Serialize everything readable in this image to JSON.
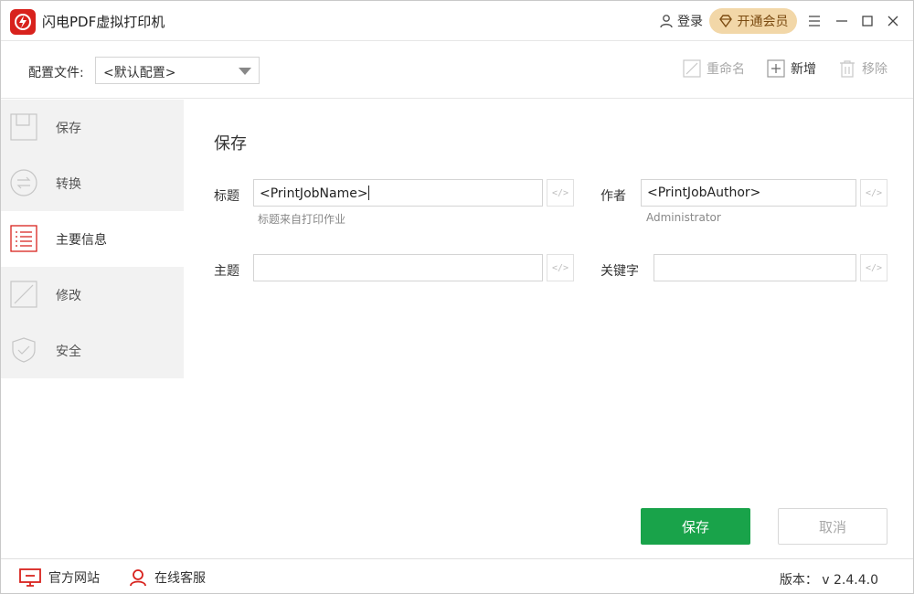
{
  "app": {
    "title": "闪电PDF虚拟打印机"
  },
  "header": {
    "login_label": "登录",
    "vip_label": "开通会员"
  },
  "toolbar": {
    "config_label": "配置文件:",
    "config_value": "<默认配置>",
    "rename_label": "重命名",
    "new_label": "新增",
    "remove_label": "移除"
  },
  "sidebar": {
    "items": [
      {
        "label": "保存",
        "icon": "save-icon"
      },
      {
        "label": "转换",
        "icon": "convert-icon"
      },
      {
        "label": "主要信息",
        "icon": "list-icon"
      },
      {
        "label": "修改",
        "icon": "edit-icon"
      },
      {
        "label": "安全",
        "icon": "shield-icon"
      }
    ]
  },
  "main": {
    "section_title": "保存",
    "fields": {
      "title": {
        "label": "标题",
        "value": "<PrintJobName>",
        "hint": "标题来自打印作业"
      },
      "author": {
        "label": "作者",
        "value": "<PrintJobAuthor>",
        "hint": "Administrator"
      },
      "subject": {
        "label": "主题",
        "value": ""
      },
      "keywords": {
        "label": "关键字",
        "value": ""
      }
    },
    "code_button_label": "</>",
    "save_label": "保存",
    "cancel_label": "取消"
  },
  "footer": {
    "website_label": "官方网站",
    "support_label": "在线客服",
    "version_label": "版本： v 2.4.4.0"
  },
  "colors": {
    "brand_red": "#d8221d",
    "accent_green": "#19a34a",
    "vip_gold": "#f2d7a8",
    "active_list_red": "#d8221d"
  }
}
